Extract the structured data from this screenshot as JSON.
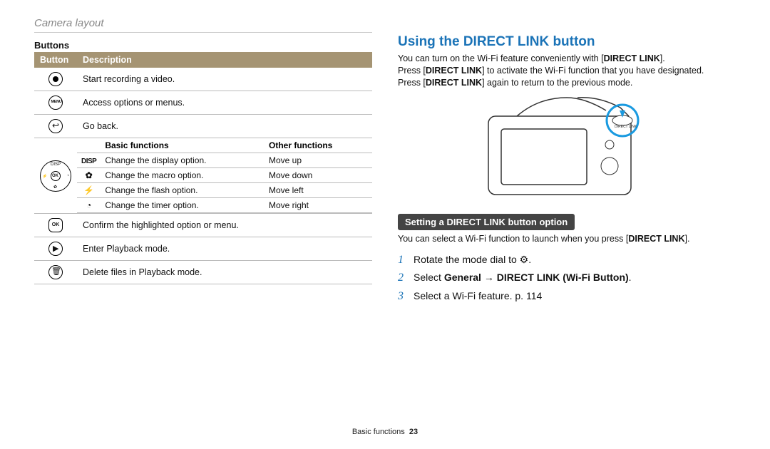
{
  "header": {
    "section": "Camera layout"
  },
  "left": {
    "title": "Buttons",
    "th_button": "Button",
    "th_desc": "Description",
    "rows": {
      "rec": "Start recording a video.",
      "menu": "Access options or menus.",
      "back": "Go back.",
      "ok": "Confirm the highlighted option or menu.",
      "play": "Enter Playback mode.",
      "trash": "Delete files in Playback mode."
    },
    "inner": {
      "th_basic": "Basic functions",
      "th_other": "Other functions",
      "r1_sym": "DISP",
      "r1_basic": "Change the display option.",
      "r1_other": "Move up",
      "r2_sym": "✿",
      "r2_basic": "Change the macro option.",
      "r2_other": "Move down",
      "r3_sym": "⚡",
      "r3_basic": "Change the flash option.",
      "r3_other": "Move left",
      "r4_sym": "◔",
      "r4_basic": "Change the timer option.",
      "r4_other": "Move right"
    }
  },
  "right": {
    "heading": "Using the DIRECT LINK button",
    "p1a": "You can turn on the Wi-Fi feature conveniently with [",
    "p1b": "DIRECT LINK",
    "p1c": "].",
    "p2a": "Press [",
    "p2b": "DIRECT LINK",
    "p2c": "] to activate the Wi-Fi function that you have designated.",
    "p3a": "Press [",
    "p3b": "DIRECT LINK",
    "p3c": "] again to return to the previous mode.",
    "pill": "Setting a DIRECT LINK button option",
    "p4a": "You can select a Wi-Fi function to launch when you press [",
    "p4b": "DIRECT LINK",
    "p4c": "].",
    "step1a": "Rotate the mode dial to ",
    "step1b": "⚙",
    "step1c": ".",
    "step2a": "Select ",
    "step2b": "General → DIRECT LINK (Wi-Fi Button)",
    "step2c": ".",
    "step3": "Select a Wi-Fi feature. p. 114"
  },
  "footer": {
    "label": "Basic functions",
    "page": "23"
  }
}
